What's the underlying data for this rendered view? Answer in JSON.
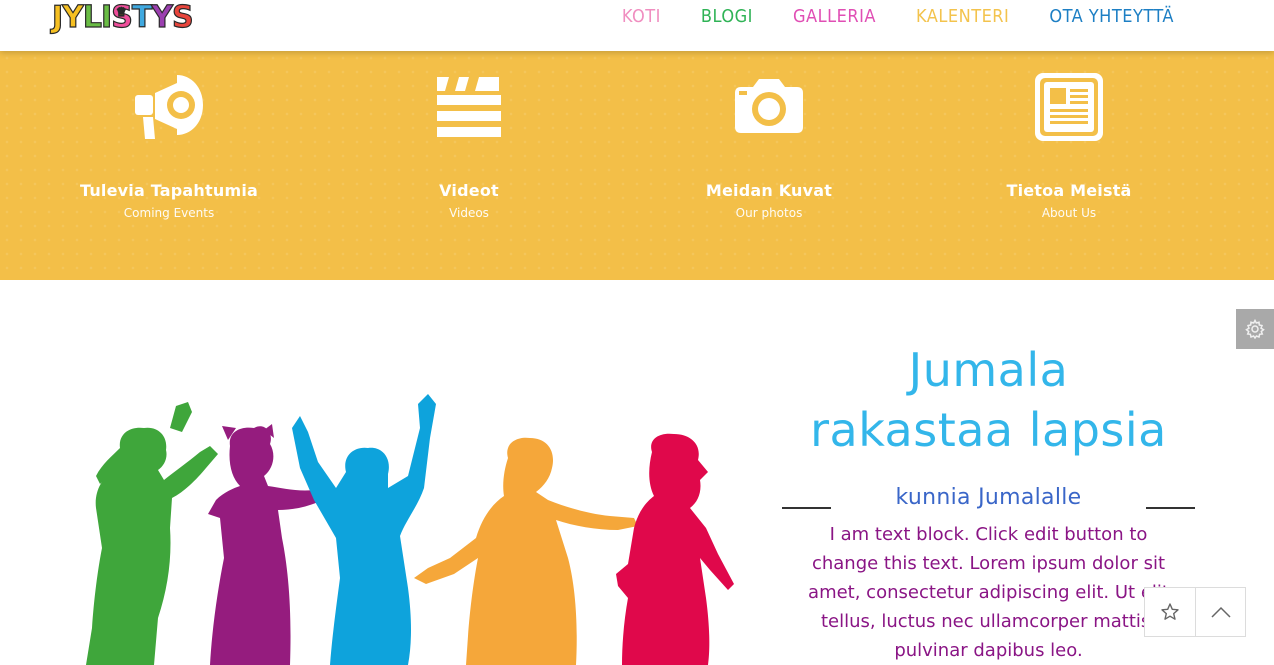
{
  "header": {
    "logo_letters": [
      "J",
      "Y",
      "L",
      "I",
      "S",
      "T",
      "Y",
      "S"
    ],
    "logo_colors": [
      "#f6c022",
      "#f6c022",
      "#6abd45",
      "#6abd45",
      "#ef4e9b",
      "#3fa9e0",
      "#9b3fb0",
      "#e8453c"
    ],
    "nav": [
      {
        "label": "KOTI",
        "color": "#f08ec0"
      },
      {
        "label": "BLOGI",
        "color": "#2fb356"
      },
      {
        "label": "GALLERIA",
        "color": "#e04eb4"
      },
      {
        "label": "KALENTERI",
        "color": "#f3c34d"
      },
      {
        "label": "OTA YHTEYTTÄ",
        "color": "#1d7fc4"
      }
    ]
  },
  "features": [
    {
      "icon": "megaphone-icon",
      "title": "Tulevia Tapahtumia",
      "subtitle": "Coming Events"
    },
    {
      "icon": "video-clapper-icon",
      "title": "Videot",
      "subtitle": "Videos"
    },
    {
      "icon": "camera-icon",
      "title": "Meidan Kuvat",
      "subtitle": "Our photos"
    },
    {
      "icon": "newspaper-icon",
      "title": "Tietoa Meistä",
      "subtitle": "About Us"
    }
  ],
  "hero": {
    "title_line1": "Jumala",
    "title_line2": "rakastaa lapsia",
    "subtitle": "kunnia Jumalalle",
    "body": "I am text block. Click edit button to change this text. Lorem ipsum dolor sit amet, consectetur adipiscing elit. Ut elit tellus, luctus nec ullamcorper mattis, pulvinar dapibus leo."
  },
  "colors": {
    "band": "#f3bf48",
    "hero_title": "#33b6ea",
    "hero_subtitle": "#3a66c8",
    "body_text": "#8a1585",
    "kid_green": "#3fa63b",
    "kid_purple": "#951c7e",
    "kid_blue": "#0ea3dc",
    "kid_orange": "#f5a73a",
    "kid_red": "#e0084b"
  },
  "widgets": {
    "settings_icon": "gear-icon",
    "favorite_icon": "star-icon",
    "scroll_top_icon": "chevron-up-icon"
  }
}
